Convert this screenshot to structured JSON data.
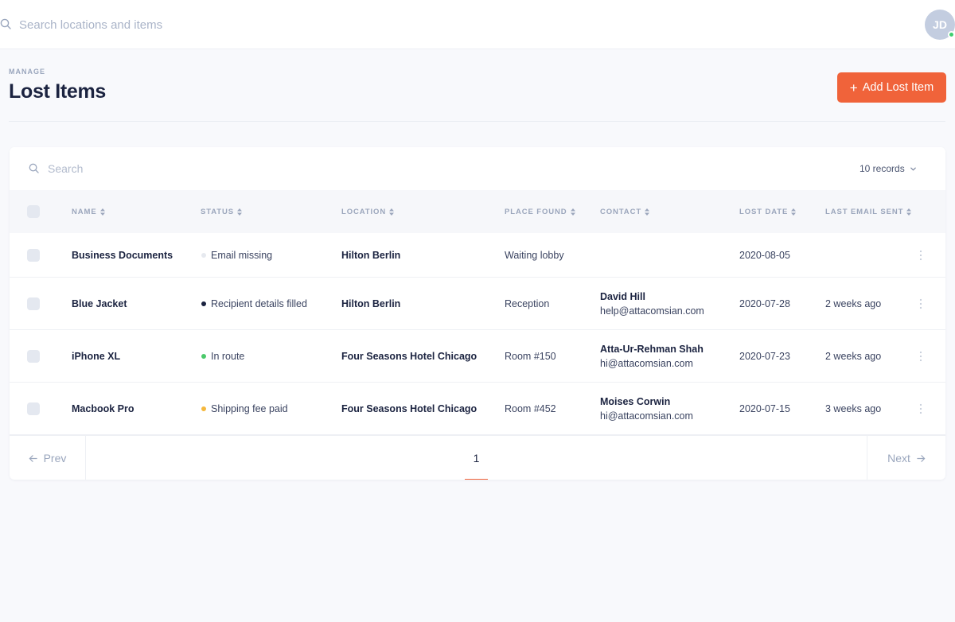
{
  "topbar": {
    "search_placeholder": "Search locations and items",
    "avatar_initials": "JD",
    "online_color": "#3fcf6f"
  },
  "header": {
    "eyebrow": "MANAGE",
    "title": "Lost Items",
    "add_button_label": "Add Lost Item",
    "accent_color": "#f0633a"
  },
  "table": {
    "search_placeholder": "Search",
    "records_label": "10 records",
    "columns": [
      "NAME",
      "STATUS",
      "LOCATION",
      "PLACE FOUND",
      "CONTACT",
      "LOST DATE",
      "LAST EMAIL SENT"
    ],
    "rows": [
      {
        "name": "Business Documents",
        "status": "Email missing",
        "status_color": "#e6e9ef",
        "location": "Hilton Berlin",
        "place_found": "Waiting lobby",
        "contact_name": "",
        "contact_email": "",
        "lost_date": "2020-08-05",
        "last_email_sent": ""
      },
      {
        "name": "Blue Jacket",
        "status": "Recipient details filled",
        "status_color": "#1b2340",
        "location": "Hilton Berlin",
        "place_found": "Reception",
        "contact_name": "David Hill",
        "contact_email": "help@attacomsian.com",
        "lost_date": "2020-07-28",
        "last_email_sent": "2 weeks ago"
      },
      {
        "name": "iPhone XL",
        "status": "In route",
        "status_color": "#4cc96b",
        "location": "Four Seasons Hotel Chicago",
        "place_found": "Room #150",
        "contact_name": "Atta-Ur-Rehman Shah",
        "contact_email": "hi@attacomsian.com",
        "lost_date": "2020-07-23",
        "last_email_sent": "2 weeks ago"
      },
      {
        "name": "Macbook Pro",
        "status": "Shipping fee paid",
        "status_color": "#f5b83d",
        "location": "Four Seasons Hotel Chicago",
        "place_found": "Room #452",
        "contact_name": "Moises Corwin",
        "contact_email": "hi@attacomsian.com",
        "lost_date": "2020-07-15",
        "last_email_sent": "3 weeks ago"
      }
    ]
  },
  "pagination": {
    "prev_label": "Prev",
    "next_label": "Next",
    "current_page": "1"
  }
}
